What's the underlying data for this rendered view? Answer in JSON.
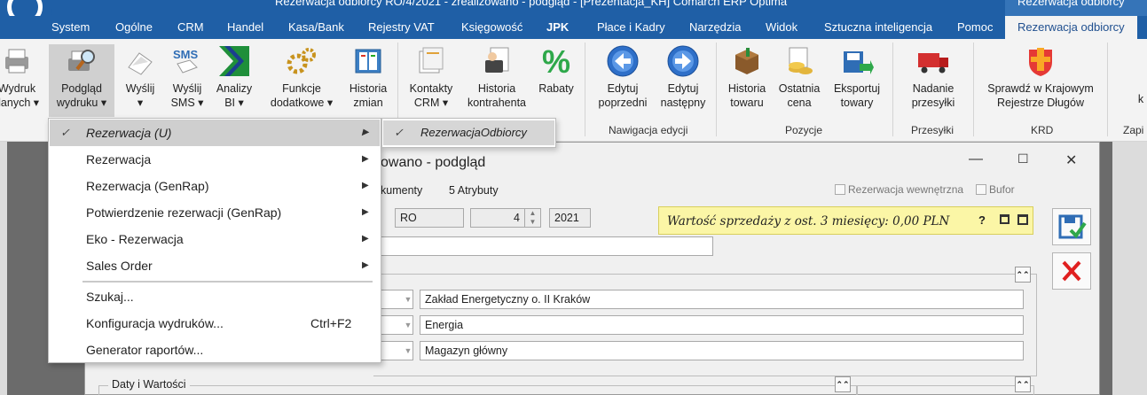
{
  "titlebar": {
    "title": "Rezerwacja odbiorcy RO/4/2021 - zrealizowano - podgląd - [Prezentacja_KH] Comarch ERP Optima",
    "context_tab": "Rezerwacja odbiorcy"
  },
  "tabs": [
    {
      "label": "System"
    },
    {
      "label": "Ogólne"
    },
    {
      "label": "CRM"
    },
    {
      "label": "Handel"
    },
    {
      "label": "Kasa/Bank"
    },
    {
      "label": "Rejestry VAT"
    },
    {
      "label": "Księgowość"
    },
    {
      "label": "JPK"
    },
    {
      "label": "Płace i Kadry"
    },
    {
      "label": "Narzędzia"
    },
    {
      "label": "Widok"
    },
    {
      "label": "Sztuczna inteligencja"
    },
    {
      "label": "Pomoc"
    },
    {
      "label": "Rezerwacja odbiorcy"
    }
  ],
  "ribbon": {
    "buttons": [
      {
        "line1": "Wydruk",
        "line2": "danych ▾"
      },
      {
        "line1": "Podgląd",
        "line2": "wydruku ▾"
      },
      {
        "line1": "Wyślij",
        "line2": "▾"
      },
      {
        "line1": "Wyślij",
        "line2": "SMS ▾"
      },
      {
        "line1": "Analizy",
        "line2": "BI ▾"
      },
      {
        "line1": "Funkcje",
        "line2": "dodatkowe ▾"
      },
      {
        "line1": "Historia",
        "line2": "zmian"
      },
      {
        "line1": "Kontakty",
        "line2": "CRM ▾"
      },
      {
        "line1": "Historia",
        "line2": "kontrahenta"
      },
      {
        "line1": "Rabaty",
        "line2": ""
      },
      {
        "line1": "Edytuj",
        "line2": "poprzedni"
      },
      {
        "line1": "Edytuj",
        "line2": "następny"
      },
      {
        "line1": "Historia",
        "line2": "towaru"
      },
      {
        "line1": "Ostatnia",
        "line2": "cena"
      },
      {
        "line1": "Eksportuj",
        "line2": "towary"
      },
      {
        "line1": "Nadanie",
        "line2": "przesyłki"
      },
      {
        "line1": "Sprawdź w Krajowym",
        "line2": "Rejestrze Długów"
      },
      {
        "line1": "k",
        "line2": ""
      }
    ],
    "groups": [
      "Nawigacja edycji",
      "Pozycje",
      "Przesyłki",
      "KRD",
      "Zapi"
    ]
  },
  "menu": {
    "items": [
      {
        "label": "Rezerwacja (U)",
        "checked": "✓",
        "arrow": "▶"
      },
      {
        "label": "Rezerwacja",
        "arrow": "▶"
      },
      {
        "label": "Rezerwacja (GenRap)",
        "arrow": "▶"
      },
      {
        "label": "Potwierdzenie rezerwacji (GenRap)",
        "arrow": "▶"
      },
      {
        "label": "Eko - Rezerwacja",
        "arrow": "▶"
      },
      {
        "label": "Sales Order",
        "arrow": "▶"
      },
      {
        "label": "Szukaj..."
      },
      {
        "label": "Konfiguracja wydruków...",
        "shortcut": "Ctrl+F2"
      },
      {
        "label": "Generator raportów..."
      }
    ],
    "submenu": {
      "label": "RezerwacjaOdbiorcy",
      "checked": "✓"
    }
  },
  "form": {
    "title": "owano - podgląd",
    "tab_dokumenty": "kumenty",
    "tab_atrybuty": "5 Atrybuty",
    "chk_wewnetrzna": "Rezerwacja wewnętrzna",
    "chk_bufor": "Bufor",
    "doc_type": "RO",
    "doc_number": "4",
    "doc_year": "2021",
    "hint": "Wartość sprzedaży z ost. 3 miesięcy: 0,00 PLN",
    "hint_q": "?",
    "contractor": "Zakład Energetyczny o. II Kraków",
    "category": "Energia",
    "warehouse": "Magazyn główny",
    "section_dates": "Daty i Wartości",
    "min_label": "—",
    "max_label": "☐",
    "close_label": "✕"
  }
}
